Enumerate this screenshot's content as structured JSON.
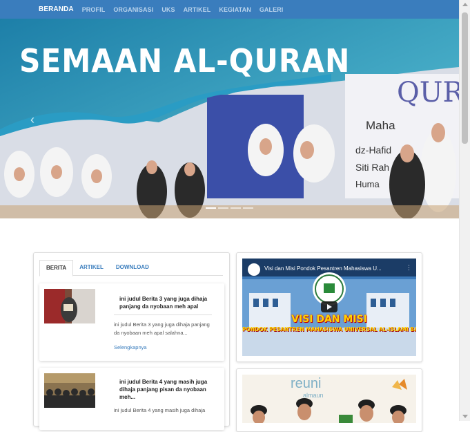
{
  "nav": {
    "items": [
      "BERANDA",
      "PROFIL",
      "ORGANISASI",
      "UKS",
      "ARTIKEL",
      "KEGIATAN",
      "GALERI"
    ]
  },
  "hero": {
    "title": "SEMAAN AL-QURAN"
  },
  "tabs": [
    "BERITA",
    "ARTIKEL",
    "DOWNLOAD"
  ],
  "posts": [
    {
      "title": "ini judul Berita 3 yang juga dihaja panjang da nyobaan meh apal",
      "excerpt": "ini judul Berita 3 yang juga  dihaja panjang da nyobaan meh apal salahna...",
      "more": "Selengkapnya"
    },
    {
      "title": "ini judul Berita 4 yang masih juga dihaja panjang pisan da nyobaan meh...",
      "excerpt": "ini judul Berita 4 yang masih juga dihaja"
    }
  ],
  "video": {
    "title": "Visi dan Misi Pondok Pesantren Mahasiswa U...",
    "heading": "VISI DAN MISI",
    "subheading": "PONDOK PESANTREN MAHASISWA UNIVERSAL AL-ISLAMI BANDUNG"
  },
  "gallery": {
    "word": "reuni",
    "sub": "almaun"
  },
  "colors": {
    "nav_bg": "#3a7dbd",
    "link": "#3a7dbd",
    "hero_teal": "#3aa9c9"
  }
}
